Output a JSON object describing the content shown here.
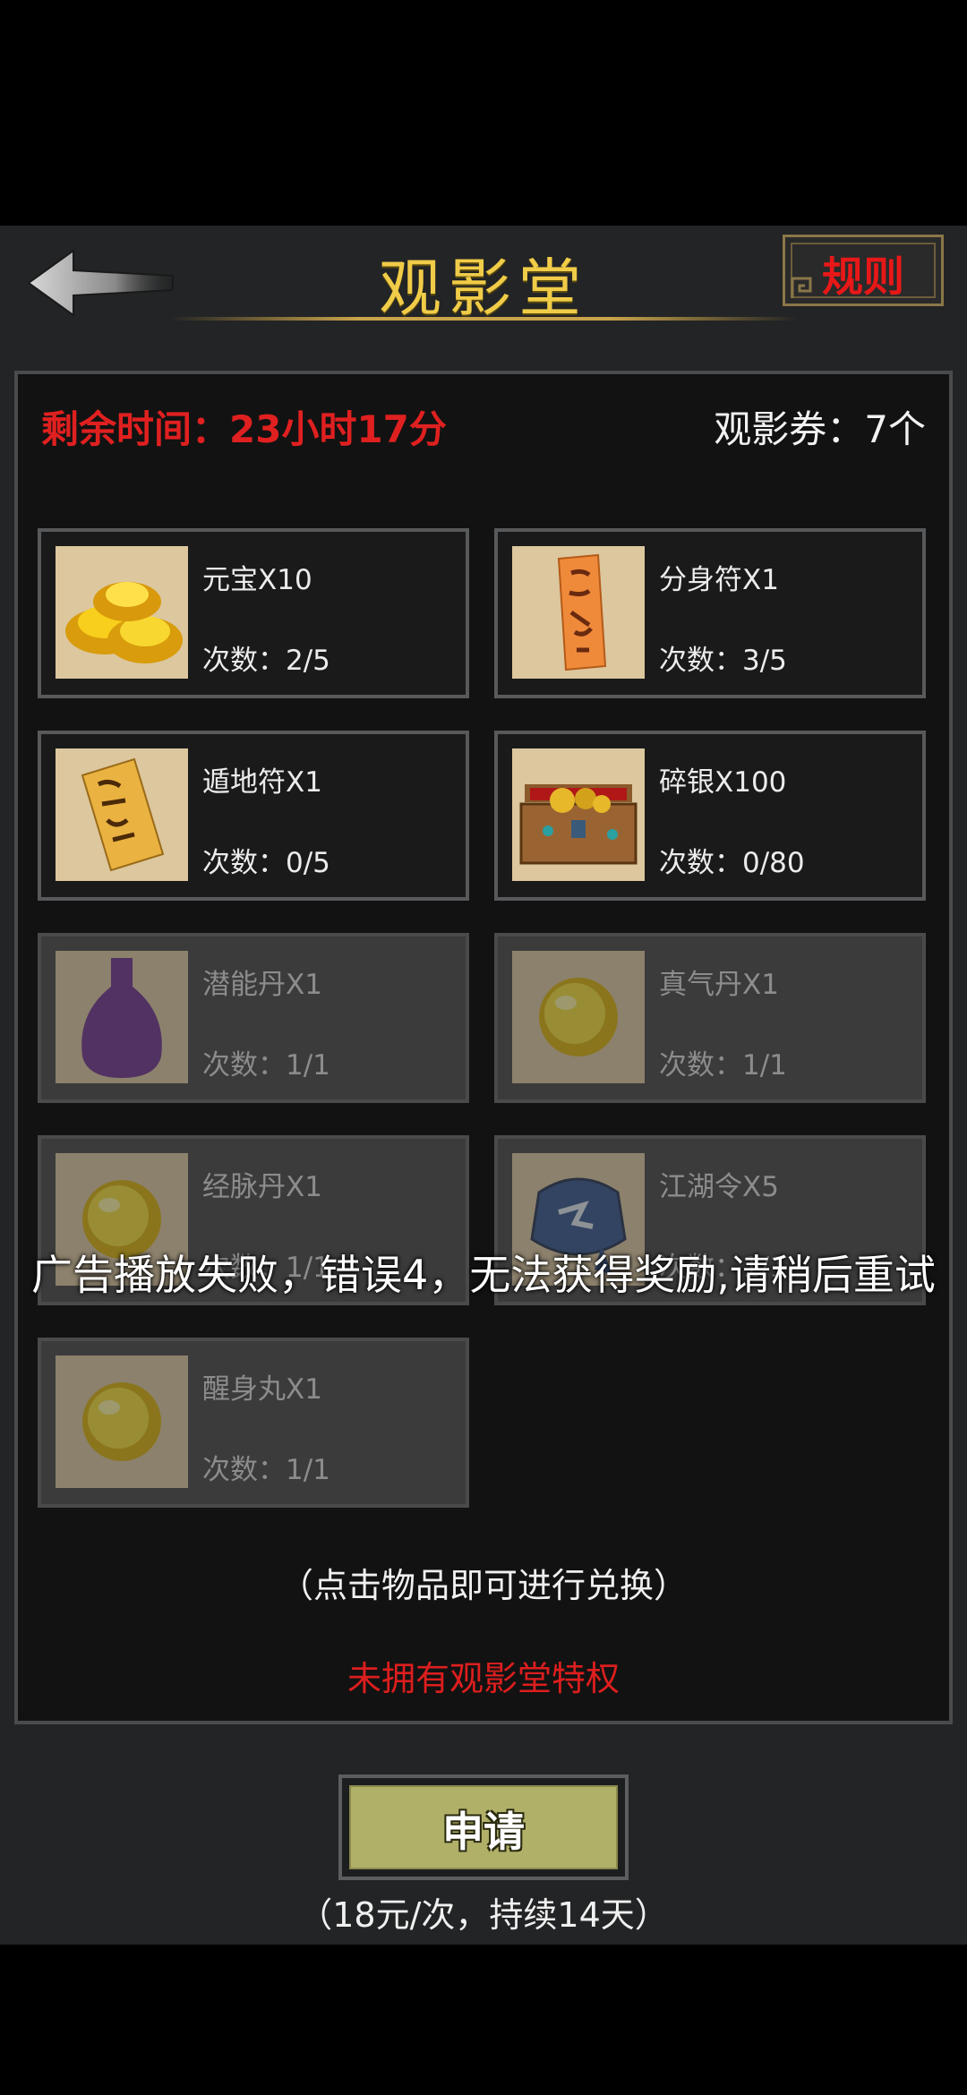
{
  "header": {
    "title": "观影堂",
    "rules_label": "规则"
  },
  "status": {
    "remaining_time": "剩余时间：23小时17分",
    "tickets": "观影券：7个"
  },
  "items": [
    {
      "name": "元宝X10",
      "count": "次数：2/5",
      "icon": "gold-ingot-icon",
      "enabled": true
    },
    {
      "name": "分身符X1",
      "count": "次数：3/5",
      "icon": "clone-talisman-icon",
      "enabled": true
    },
    {
      "name": "遁地符X1",
      "count": "次数：0/5",
      "icon": "earth-escape-talisman-icon",
      "enabled": true
    },
    {
      "name": "碎银X100",
      "count": "次数：0/80",
      "icon": "treasure-chest-icon",
      "enabled": true
    },
    {
      "name": "潜能丹X1",
      "count": "次数：1/1",
      "icon": "potion-bottle-icon",
      "enabled": false
    },
    {
      "name": "真气丹X1",
      "count": "次数：1/1",
      "icon": "yellow-pill-icon",
      "enabled": false
    },
    {
      "name": "经脉丹X1",
      "count": "次数：1/1",
      "icon": "yellow-pill-icon",
      "enabled": false
    },
    {
      "name": "江湖令X5",
      "count": "次数：1/1",
      "icon": "token-pouch-icon",
      "enabled": false
    },
    {
      "name": "醒身丸X1",
      "count": "次数：1/1",
      "icon": "yellow-pill-icon",
      "enabled": false
    }
  ],
  "hint": "（点击物品即可进行兑换）",
  "privilege_notice": "未拥有观影堂特权",
  "apply_button": "申请",
  "price_note": "（18元/次，持续14天）",
  "toast": "广告播放失败，错误4，无法获得奖励,请稍后重试",
  "colors": {
    "title": "#f0cc48",
    "warning_red": "#e02020",
    "apply_button": "#b1b068"
  }
}
